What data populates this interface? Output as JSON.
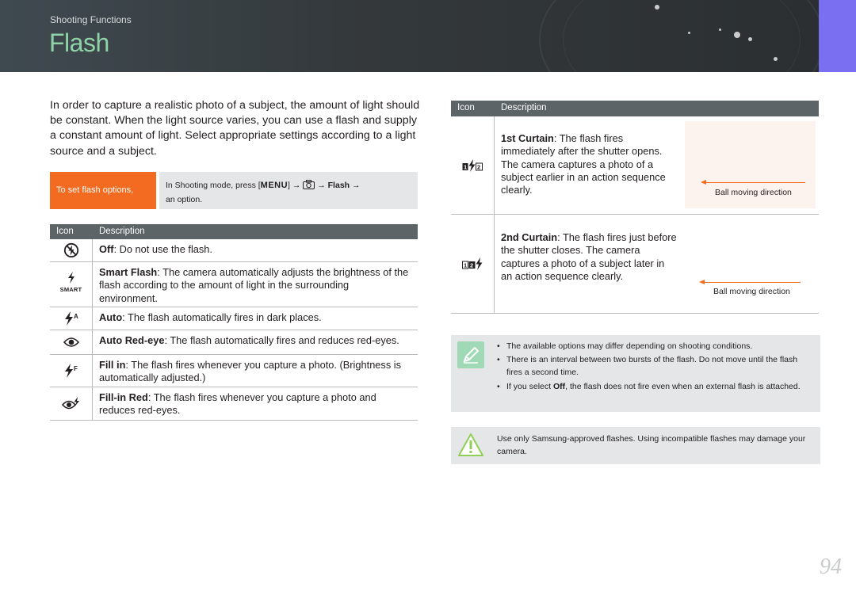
{
  "header": {
    "section": "Shooting Functions",
    "title": "Flash"
  },
  "intro": "In order to capture a realistic photo of a subject, the amount of light should be constant. When the light source varies, you can use a flash and supply a constant amount of light. Select appropriate settings according to a light source and a subject.",
  "howto": {
    "label": "To set flash options,",
    "text_prefix": "In Shooting mode, press [",
    "menu": "MENU",
    "text_mid": "] → ",
    "text_flash": " → Flash →",
    "text_suffix": "an option."
  },
  "left_table": {
    "col_icon": "Icon",
    "col_desc": "Description",
    "rows": [
      {
        "icon": "flash-off-icon",
        "name": "Off",
        "text": ": Do not use the flash."
      },
      {
        "icon": "smart-flash-icon",
        "icon_sub": "SMART",
        "name": "Smart Flash",
        "text": ": The camera automatically adjusts the brightness of the flash according to the amount of light in the surrounding environment."
      },
      {
        "icon": "flash-auto-icon",
        "name": "Auto",
        "text": ": The flash automatically fires in dark places."
      },
      {
        "icon": "red-eye-icon",
        "name": "Auto Red-eye",
        "text": ": The flash automatically fires and reduces red-eyes."
      },
      {
        "icon": "fill-in-flash-icon",
        "name": "Fill in",
        "text": ": The flash fires whenever you capture a photo. (Brightness is automatically adjusted.)"
      },
      {
        "icon": "fill-in-red-eye-icon",
        "name": "Fill-in Red",
        "text": ": The flash fires whenever you capture a photo and reduces red-eyes."
      }
    ]
  },
  "right_table": {
    "col_icon": "Icon",
    "col_desc": "Description",
    "rows": [
      {
        "icon": "first-curtain-icon",
        "name": "1st Curtain",
        "text": ": The flash fires immediately after the shutter opens. The camera captures a photo of a subject earlier in an action sequence clearly.",
        "caption": "Ball moving direction"
      },
      {
        "icon": "second-curtain-icon",
        "name": "2nd Curtain",
        "text": ": The flash fires just before the shutter closes. The camera captures a photo of a subject later in an action sequence clearly.",
        "caption": "Ball moving direction"
      }
    ]
  },
  "note": {
    "items": [
      "The available options may differ depending on shooting conditions.",
      "There is an interval between two bursts of the flash. Do not move until the flash fires a second time."
    ],
    "item3_prefix": "If you select ",
    "item3_bold": "Off",
    "item3_suffix": ", the flash does not fire even when an external flash is attached."
  },
  "warning": "Use only Samsung-approved flashes. Using incompatible flashes may damage your camera.",
  "page_number": "94",
  "colors": {
    "accent_orange": "#f26b21",
    "title_green": "#8fd3a8",
    "tab_purple": "#7a6ff0",
    "table_header": "#5d6468",
    "note_bg": "#e4e6e8"
  }
}
